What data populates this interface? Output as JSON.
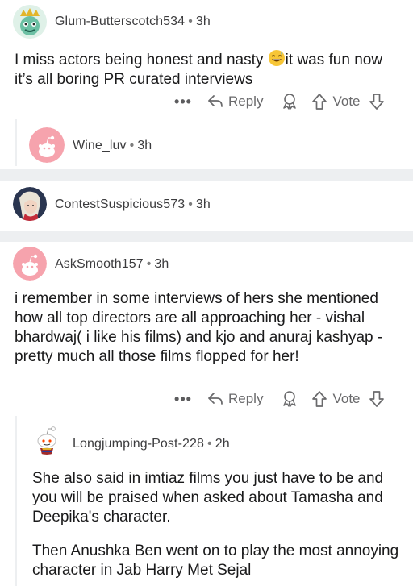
{
  "comments": [
    {
      "username": "Glum-Butterscotch534",
      "time": "3h",
      "text_before_emoji": "I miss actors being honest and nasty ",
      "emoji": "grinning-sweat-emoji",
      "text_after_emoji": "it was fun now it’s all boring PR curated interviews"
    },
    {
      "username": "Wine_luv",
      "time": "3h"
    },
    {
      "username": "ContestSuspicious573",
      "time": "3h"
    },
    {
      "username": "AskSmooth157",
      "time": "3h",
      "text": "i remember in some interviews of hers she mentioned how all top directors are all approaching her - vishal bhardwaj( i like his films) and kjo and anuraj kashyap - pretty much all those films flopped for her!"
    },
    {
      "username": "Longjumping-Post-228",
      "time": "2h",
      "paragraphs": [
        "She also said in imtiaz films you just have to be and you will be praised when asked about Tamasha and Deepika's character.",
        "Then Anushka Ben went on to play the most annoying character in Jab Harry Met Sejal"
      ]
    }
  ],
  "actions": {
    "more": "•••",
    "reply": "Reply",
    "vote": "Vote"
  },
  "separator": "•",
  "colors": {
    "divider": "#edeff1",
    "snoo_pink": "#f7a8b0",
    "meta_gray": "#6a6a6c"
  }
}
